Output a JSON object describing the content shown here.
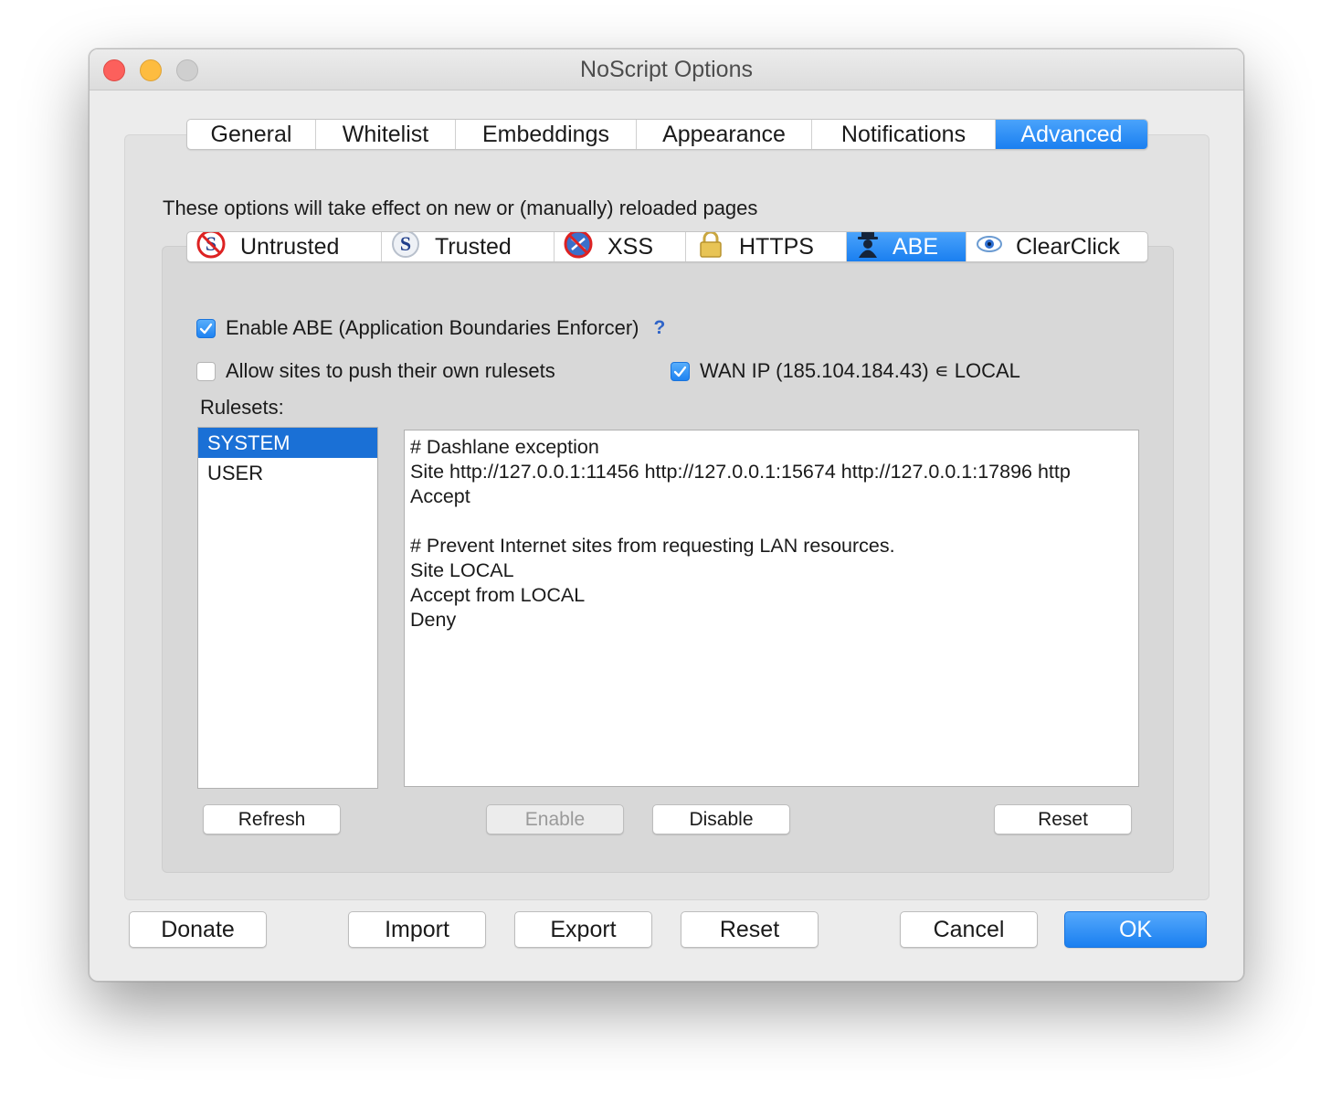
{
  "window": {
    "title": "NoScript Options"
  },
  "main_tabs": [
    {
      "label": "General"
    },
    {
      "label": "Whitelist"
    },
    {
      "label": "Embeddings"
    },
    {
      "label": "Appearance"
    },
    {
      "label": "Notifications"
    },
    {
      "label": "Advanced",
      "active": true
    }
  ],
  "note": "These options will take effect on new or (manually) reloaded pages",
  "sub_tabs": [
    {
      "label": "Untrusted",
      "icon": "untrusted-s-icon"
    },
    {
      "label": "Trusted",
      "icon": "trusted-s-icon"
    },
    {
      "label": "XSS",
      "icon": "xss-icon"
    },
    {
      "label": "HTTPS",
      "icon": "padlock-icon"
    },
    {
      "label": "ABE",
      "icon": "abe-spy-icon",
      "active": true
    },
    {
      "label": "ClearClick",
      "icon": "eye-icon"
    }
  ],
  "abe": {
    "enable_label": "Enable ABE (Application Boundaries Enforcer)",
    "enable_checked": true,
    "help": "?",
    "allow_push_label": "Allow sites to push their own rulesets",
    "allow_push_checked": false,
    "wan_label": "WAN IP (185.104.184.43) ∊ LOCAL",
    "wan_checked": true,
    "rulesets_label": "Rulesets:",
    "rulesets": [
      {
        "name": "SYSTEM",
        "selected": true
      },
      {
        "name": "USER",
        "selected": false
      }
    ],
    "rules_text": [
      "# Dashlane exception",
      "Site http://127.0.0.1:11456 http://127.0.0.1:15674 http://127.0.0.1:17896 http",
      "Accept",
      "",
      "# Prevent Internet sites from requesting LAN resources.",
      "Site LOCAL",
      "Accept from LOCAL",
      "Deny"
    ],
    "buttons": {
      "refresh": "Refresh",
      "enable": "Enable",
      "disable": "Disable",
      "reset": "Reset"
    }
  },
  "footer": {
    "donate": "Donate",
    "import": "Import",
    "export": "Export",
    "reset": "Reset",
    "cancel": "Cancel",
    "ok": "OK"
  },
  "colors": {
    "accent": "#1a7ff0",
    "selection": "#1a70d6",
    "window_bg": "#ececec"
  }
}
